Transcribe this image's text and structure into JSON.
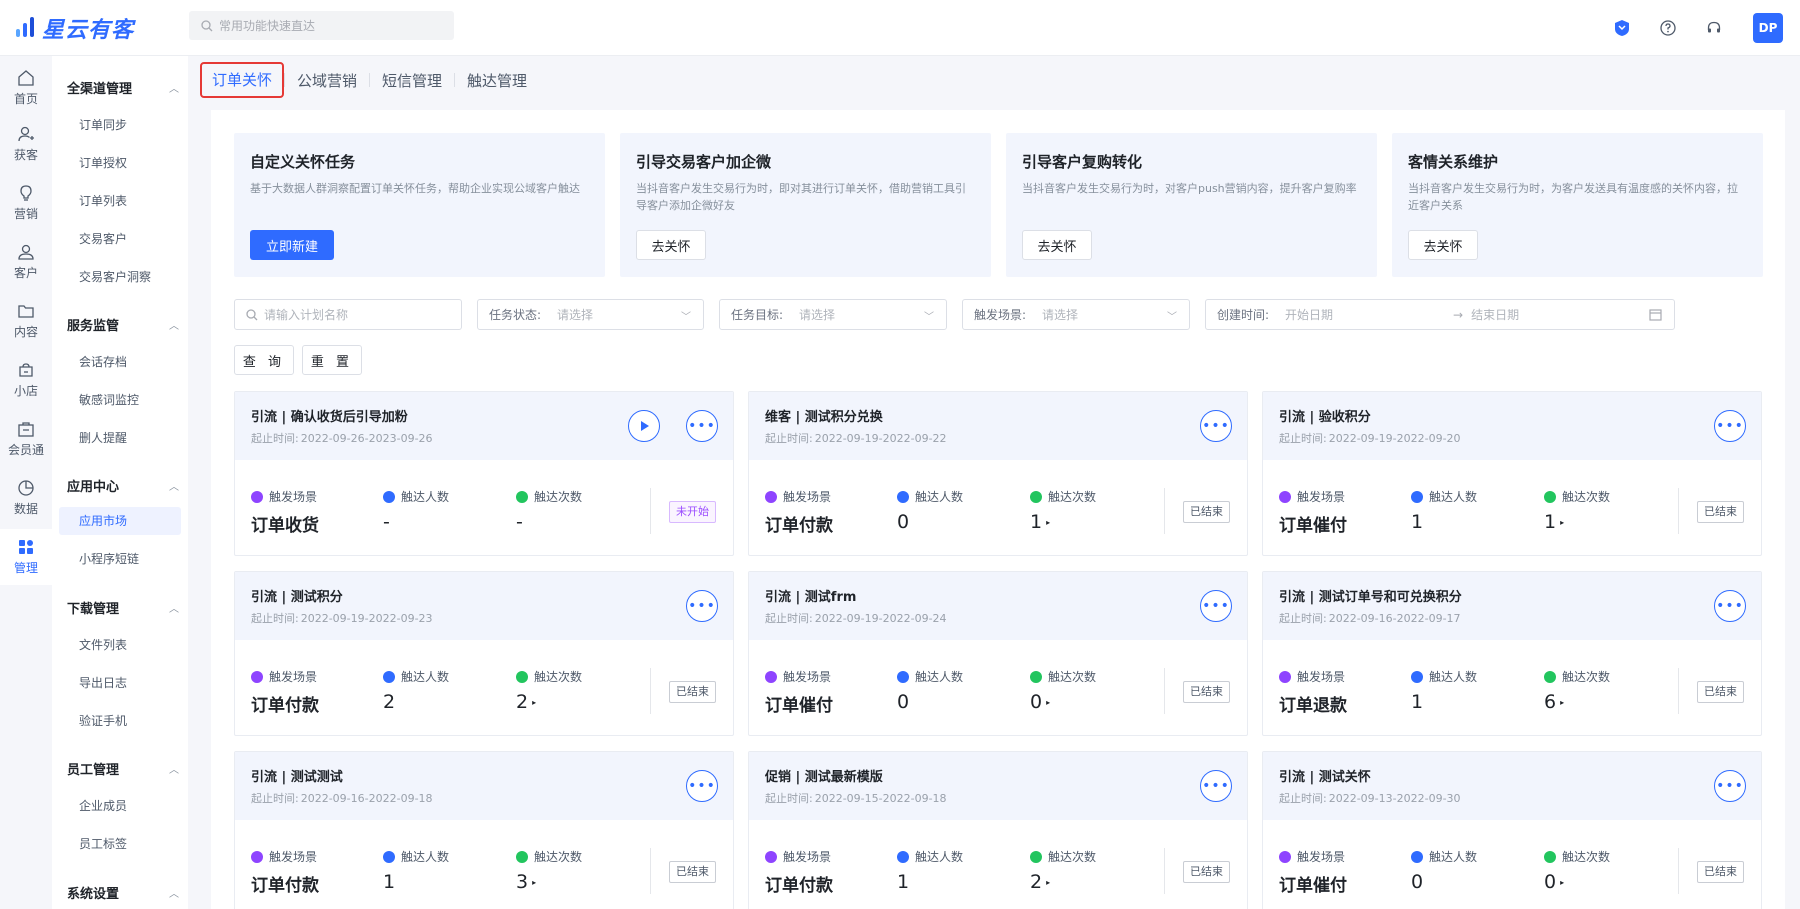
{
  "app": {
    "name": "星云有客"
  },
  "search": {
    "placeholder": "常用功能快速直达"
  },
  "header": {
    "avatar": "DP",
    "icons": [
      "shield-icon",
      "help-icon",
      "headset-icon"
    ]
  },
  "rail": [
    {
      "label": "首页",
      "icon": "home-icon"
    },
    {
      "label": "获客",
      "icon": "user-add-icon"
    },
    {
      "label": "营销",
      "icon": "bulb-icon"
    },
    {
      "label": "客户",
      "icon": "user-icon"
    },
    {
      "label": "内容",
      "icon": "folder-icon"
    },
    {
      "label": "小店",
      "icon": "shop-icon"
    },
    {
      "label": "会员通",
      "icon": "member-icon"
    },
    {
      "label": "数据",
      "icon": "chart-pie-icon"
    },
    {
      "label": "管理",
      "icon": "grid-icon",
      "active": true
    }
  ],
  "sidebar": {
    "groups": [
      {
        "title": "全渠道管理",
        "items": [
          "订单同步",
          "订单授权",
          "订单列表",
          "交易客户",
          "交易客户洞察"
        ]
      },
      {
        "title": "服务监管",
        "items": [
          "会话存档",
          "敏感词监控",
          "删人提醒"
        ]
      },
      {
        "title": "应用中心",
        "items": [
          "应用市场",
          "小程序短链"
        ]
      },
      {
        "title": "下载管理",
        "items": [
          "文件列表",
          "导出日志",
          "验证手机"
        ]
      },
      {
        "title": "员工管理",
        "items": [
          "企业成员",
          "员工标签"
        ]
      },
      {
        "title": "系统设置",
        "items": []
      }
    ]
  },
  "tabs": [
    "订单关怀",
    "公域营销",
    "短信管理",
    "触达管理"
  ],
  "cards": [
    {
      "title": "自定义关怀任务",
      "desc": "基于大数据人群洞察配置订单关怀任务，帮助企业实现公域客户触达",
      "button": "立即新建"
    },
    {
      "title": "引导交易客户加企微",
      "desc": "当抖音客户发生交易行为时，即对其进行订单关怀，借助营销工具引导客户添加企微好友",
      "button": "去关怀"
    },
    {
      "title": "引导客户复购转化",
      "desc": "当抖音客户发生交易行为时，对客户push营销内容，提升客户复购率",
      "button": "去关怀"
    },
    {
      "title": "客情关系维护",
      "desc": "当抖音客户发生交易行为时，为客户发送具有温度感的关怀内容，拉近客户关系",
      "button": "去关怀"
    }
  ],
  "filters": {
    "name_placeholder": "请输入计划名称",
    "status_label": "任务状态:",
    "status_placeholder": "请选择",
    "target_label": "任务目标:",
    "target_placeholder": "请选择",
    "scene_label": "触发场景:",
    "scene_placeholder": "请选择",
    "created_label": "创建时间:",
    "start_placeholder": "开始日期",
    "end_placeholder": "结束日期",
    "query": "查 询",
    "reset": "重 置"
  },
  "metric_labels": {
    "scene": "触发场景",
    "people": "触达人数",
    "times": "触达次数",
    "date_prefix": "起止时间:"
  },
  "tasks": [
    {
      "name": "引流 | 确认收货后引导加粉",
      "dates": "2022-09-26-2023-09-26",
      "scene": "订单收货",
      "people": "-",
      "times": "-",
      "status": "未开始",
      "play": true
    },
    {
      "name": "维客 | 测试积分兑换",
      "dates": "2022-09-19-2022-09-22",
      "scene": "订单付款",
      "people": "0",
      "times": "1",
      "status": "已结束"
    },
    {
      "name": "引流 | 验收积分",
      "dates": "2022-09-19-2022-09-20",
      "scene": "订单催付",
      "people": "1",
      "times": "1",
      "status": "已结束"
    },
    {
      "name": "引流 | 测试积分",
      "dates": "2022-09-19-2022-09-23",
      "scene": "订单付款",
      "people": "2",
      "times": "2",
      "status": "已结束"
    },
    {
      "name": "引流 | 测试frm",
      "dates": "2022-09-19-2022-09-24",
      "scene": "订单催付",
      "people": "0",
      "times": "0",
      "status": "已结束"
    },
    {
      "name": "引流 | 测试订单号和可兑换积分",
      "dates": "2022-09-16-2022-09-17",
      "scene": "订单退款",
      "people": "1",
      "times": "6",
      "status": "已结束"
    },
    {
      "name": "引流 | 测试测试",
      "dates": "2022-09-16-2022-09-18",
      "scene": "订单付款",
      "people": "1",
      "times": "3",
      "status": "已结束"
    },
    {
      "name": "促销 | 测试最新模版",
      "dates": "2022-09-15-2022-09-18",
      "scene": "订单付款",
      "people": "1",
      "times": "2",
      "status": "已结束"
    },
    {
      "name": "引流 | 测试关怀",
      "dates": "2022-09-13-2022-09-30",
      "scene": "订单催付",
      "people": "0",
      "times": "0",
      "status": "已结束"
    }
  ],
  "colors": {
    "accent": "#2f6bff",
    "scene_dot": "#8e44ff",
    "people_dot": "#2f6bff",
    "times_dot": "#22c55e",
    "tab_highlight": "#e53935"
  }
}
